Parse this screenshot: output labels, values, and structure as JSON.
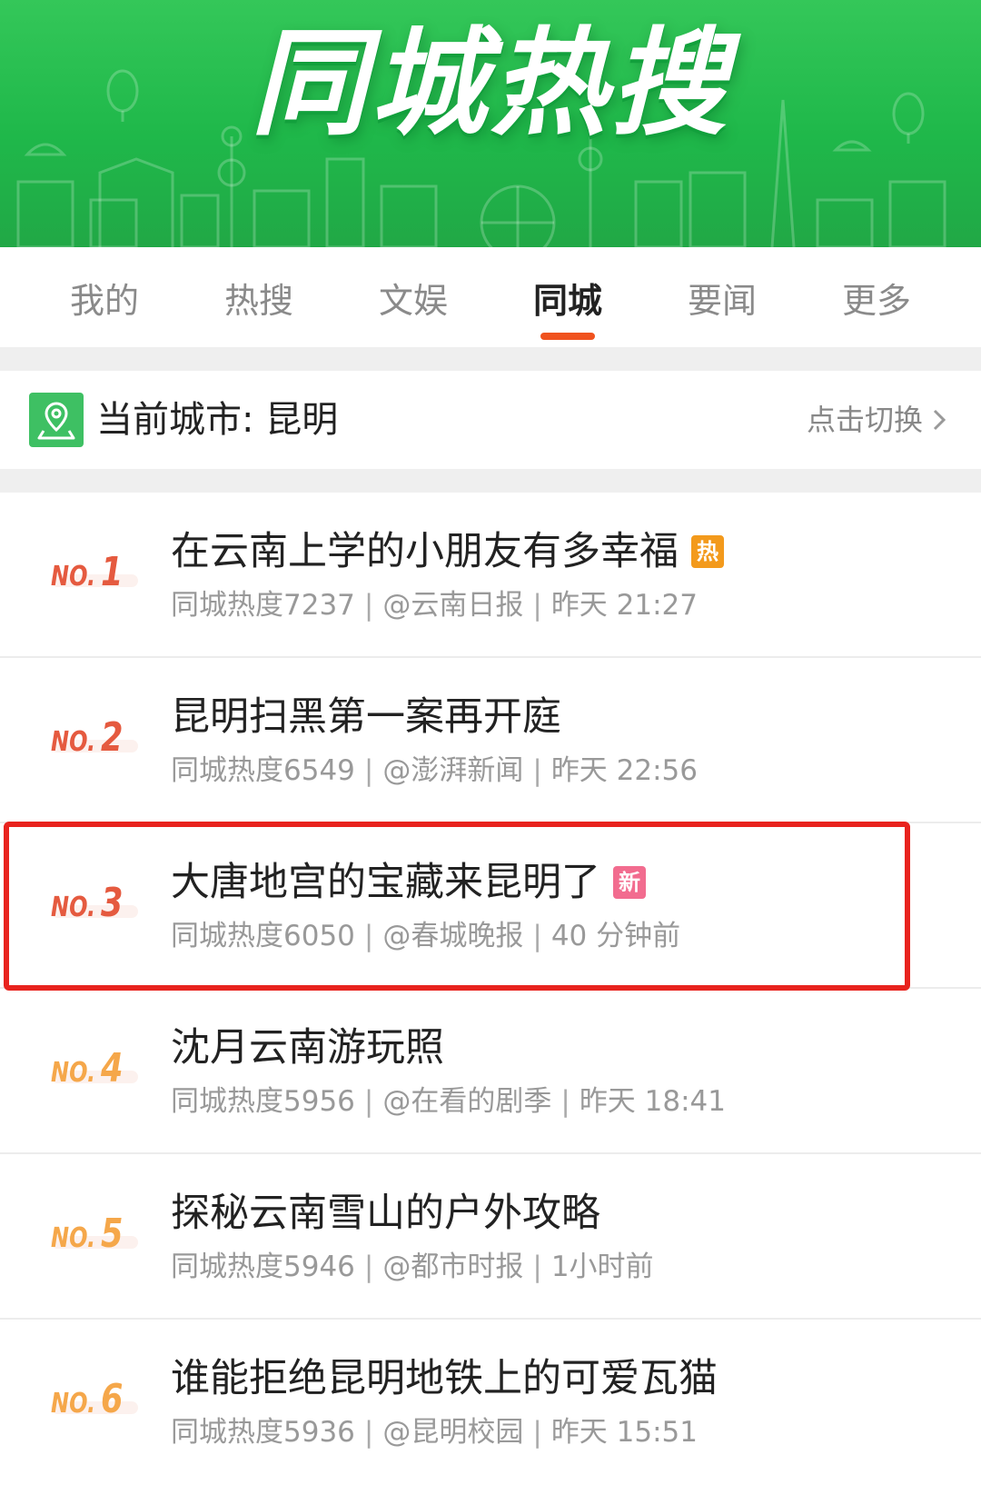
{
  "banner": {
    "title": "同城热搜"
  },
  "tabs": [
    {
      "label": "我的",
      "active": false
    },
    {
      "label": "热搜",
      "active": false
    },
    {
      "label": "文娱",
      "active": false
    },
    {
      "label": "同城",
      "active": true
    },
    {
      "label": "要闻",
      "active": false
    },
    {
      "label": "更多",
      "active": false
    }
  ],
  "city": {
    "label": "当前城市: 昆明",
    "switch_label": "点击切换"
  },
  "list": [
    {
      "rank_prefix": "NO.",
      "rank": "1",
      "title": "在云南上学的小朋友有多幸福",
      "badge": "热",
      "heat": "同城热度7237",
      "source": "@云南日报",
      "time": "昨天 21:27"
    },
    {
      "rank_prefix": "NO.",
      "rank": "2",
      "title": "昆明扫黑第一案再开庭",
      "badge": "",
      "heat": "同城热度6549",
      "source": "@澎湃新闻",
      "time": "昨天 22:56"
    },
    {
      "rank_prefix": "NO.",
      "rank": "3",
      "title": "大唐地宫的宝藏来昆明了",
      "badge": "新",
      "heat": "同城热度6050",
      "source": "@春城晚报",
      "time": "40 分钟前"
    },
    {
      "rank_prefix": "NO.",
      "rank": "4",
      "title": "沈月云南游玩照",
      "badge": "",
      "heat": "同城热度5956",
      "source": "@在看的剧季",
      "time": "昨天 18:41"
    },
    {
      "rank_prefix": "NO.",
      "rank": "5",
      "title": "探秘云南雪山的户外攻略",
      "badge": "",
      "heat": "同城热度5946",
      "source": "@都市时报",
      "time": "1小时前"
    },
    {
      "rank_prefix": "NO.",
      "rank": "6",
      "title": "谁能拒绝昆明地铁上的可爱瓦猫",
      "badge": "",
      "heat": "同城热度5936",
      "source": "@昆明校园",
      "time": "昨天 15:51"
    }
  ],
  "colors": {
    "brand_green": "#21b84c",
    "accent_orange": "#f0521e",
    "rank_top": "#e55a3f",
    "rank_other": "#f5a74a",
    "badge_hot": "#f39a1c",
    "badge_new": "#f26c8f",
    "highlight_red": "#e8231e"
  }
}
